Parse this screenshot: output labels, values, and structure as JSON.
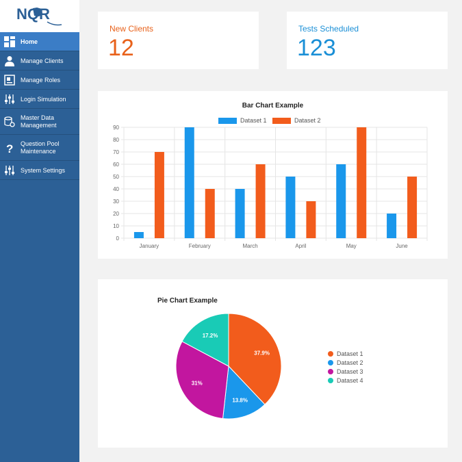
{
  "logo": {
    "text": "NQR"
  },
  "sidebar": {
    "items": [
      {
        "label": "Home",
        "icon": "dashboard-icon",
        "active": true
      },
      {
        "label": "Manage Clients",
        "icon": "user-icon",
        "active": false
      },
      {
        "label": "Manage Roles",
        "icon": "roles-icon",
        "active": false
      },
      {
        "label": "Login Simulation",
        "icon": "sliders-icon",
        "active": false
      },
      {
        "label": "Master Data Management",
        "icon": "database-gear-icon",
        "active": false
      },
      {
        "label": "Question Pool Maintenance",
        "icon": "question-icon",
        "active": false
      },
      {
        "label": "System Settings",
        "icon": "sliders-icon",
        "active": false
      }
    ]
  },
  "stats": {
    "new_clients": {
      "label": "New Clients",
      "value": "12",
      "color": "#e8611a"
    },
    "tests_scheduled": {
      "label": "Tests Scheduled",
      "value": "123",
      "color": "#1a8fd6"
    }
  },
  "colors": {
    "dataset1": "#1a97eb",
    "dataset2": "#f25c1c",
    "dataset3": "#c2169f",
    "dataset4": "#19cbb6",
    "sidebar": "#2c6096",
    "sidebar_active": "#3b7dc6"
  },
  "chart_data": [
    {
      "type": "bar",
      "title": "Bar Chart Example",
      "categories": [
        "January",
        "February",
        "March",
        "April",
        "May",
        "June"
      ],
      "series": [
        {
          "name": "Dataset 1",
          "values": [
            5,
            90,
            40,
            50,
            60,
            20
          ],
          "color": "#1a97eb"
        },
        {
          "name": "Dataset 2",
          "values": [
            70,
            40,
            60,
            30,
            90,
            50
          ],
          "color": "#f25c1c"
        }
      ],
      "ylim": [
        0,
        90
      ],
      "yticks": [
        0,
        10,
        20,
        30,
        40,
        50,
        60,
        70,
        80,
        90
      ],
      "legend": "top",
      "grid": true
    },
    {
      "type": "pie",
      "title": "Pie Chart Example",
      "labels": [
        "Dataset 1",
        "Dataset 2",
        "Dataset 3",
        "Dataset 4"
      ],
      "values": [
        37.9,
        13.8,
        31,
        17.2
      ],
      "value_labels": [
        "37.9%",
        "13.8%",
        "31%",
        "17.2%"
      ],
      "colors": [
        "#f25c1c",
        "#1a97eb",
        "#c2169f",
        "#19cbb6"
      ],
      "legend": "right"
    }
  ]
}
